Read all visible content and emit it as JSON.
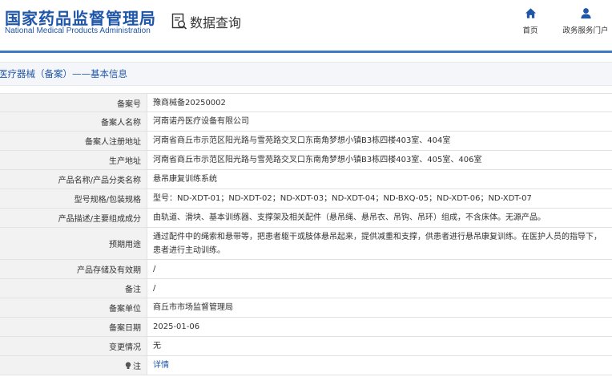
{
  "header": {
    "logo_cn": "国家药品监督管理局",
    "logo_en": "National Medical Products Administration",
    "data_query": "数据查询",
    "nav_home": "首页",
    "nav_portal": "政务服务门户"
  },
  "section": {
    "title": "医疗器械（备案）——基本信息"
  },
  "rows": [
    {
      "label": "备案号",
      "value": "豫商械备20250002"
    },
    {
      "label": "备案人名称",
      "value": "河南诺丹医疗设备有限公司"
    },
    {
      "label": "备案人注册地址",
      "value": "河南省商丘市示范区阳光路与雪苑路交叉口东南角梦想小镇B3栋四楼403室、404室"
    },
    {
      "label": "生产地址",
      "value": "河南省商丘市示范区阳光路与雪苑路交叉口东南角梦想小镇B3栋四楼403室、405室、406室"
    },
    {
      "label": "产品名称/产品分类名称",
      "value": "悬吊康复训练系统"
    },
    {
      "label": "型号规格/包装规格",
      "value": "型号：ND-XDT-01；ND-XDT-02；ND-XDT-03；ND-XDT-04；ND-BXQ-05；ND-XDT-06；ND-XDT-07"
    },
    {
      "label": "产品描述/主要组成成分",
      "value": "由轨道、滑块、基本训练器、支撑架及相关配件（悬吊绳、悬吊衣、吊钩、吊环）组成，不含床体。无源产品。"
    },
    {
      "label": "预期用途",
      "value": "通过配件中的绳索和悬带等，把患者躯干或肢体悬吊起来，提供减重和支撑，供患者进行悬吊康复训练。在医护人员的指导下，患者进行主动训练。"
    },
    {
      "label": "产品存储及有效期",
      "value": "/"
    },
    {
      "label": "备注",
      "value": "/"
    },
    {
      "label": "备案单位",
      "value": "商丘市市场监督管理局"
    },
    {
      "label": "备案日期",
      "value": "2025-01-06"
    },
    {
      "label": "变更情况",
      "value": "无"
    },
    {
      "label": "注",
      "value": "详情"
    }
  ],
  "colors": {
    "brand": "#1f56a8",
    "accent_line": "#3d79c4",
    "label_bg": "#f2f2f2"
  }
}
